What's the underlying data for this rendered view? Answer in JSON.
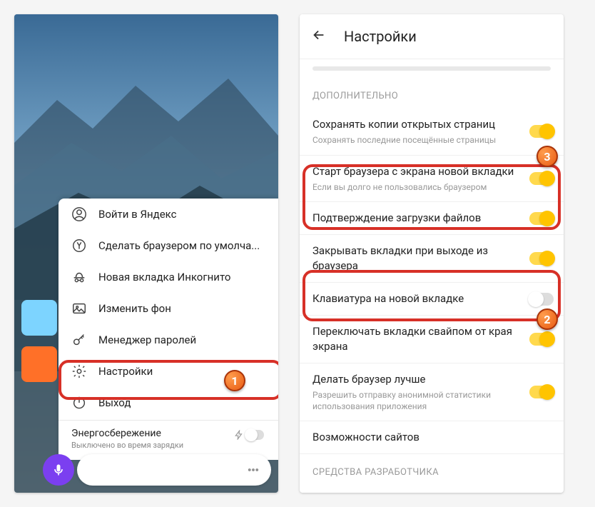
{
  "left": {
    "menu": {
      "login": "Войти в Яндекс",
      "default_browser": "Сделать браузером по умолча...",
      "incognito": "Новая вкладка Инкогнито",
      "change_bg": "Изменить фон",
      "passwords": "Менеджер паролей",
      "settings": "Настройки",
      "exit": "Выход"
    },
    "energy": {
      "title": "Энергосбережение",
      "sub": "Выключено во время зарядки"
    }
  },
  "right": {
    "header": "Настройки",
    "section1": "ДОПОЛНИТЕЛЬНО",
    "save_copies": {
      "title": "Сохранять копии открытых страниц",
      "sub": "Сохранять последние посещённые страницы"
    },
    "start_newtab": {
      "title": "Старт браузера с экрана новой вкладки",
      "sub": "Если вы долго не пользовались браузером"
    },
    "download_confirm": "Подтверждение загрузки файлов",
    "close_on_exit": "Закрывать вкладки при выходе из браузера",
    "keyboard_newtab": "Клавиатура на новой вкладке",
    "swipe_tabs": "Переключать вкладки свайпом от края экрана",
    "improve": {
      "title": "Делать браузер лучше",
      "sub": "Разрешить отправку анонимной статистики использования приложения"
    },
    "site_features": "Возможности сайтов",
    "section2": "СРЕДСТВА РАЗРАБОТЧИКА"
  },
  "badges": {
    "one": "1",
    "two": "2",
    "three": "3"
  }
}
